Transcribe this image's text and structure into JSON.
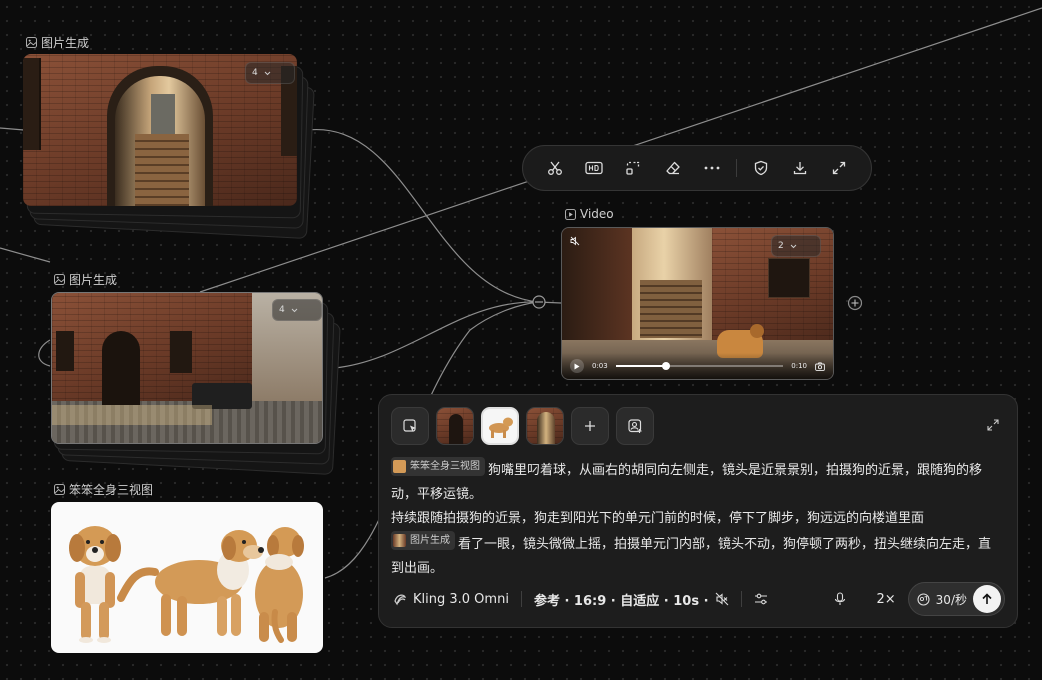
{
  "nodes": {
    "image_gen_1": {
      "label": "图片生成",
      "badge_count": "4"
    },
    "image_gen_2": {
      "label": "图片生成",
      "badge_count": "4"
    },
    "reference": {
      "label": "笨笨全身三视图"
    },
    "video": {
      "label": "Video",
      "badge_count": "2",
      "time_current": "0:03",
      "time_total": "0:10",
      "progress": 0.3
    }
  },
  "toolbar": {
    "items": [
      "scissors-icon",
      "hd-icon",
      "crop-icon",
      "eraser-icon",
      "more-icon",
      "shield-icon",
      "download-icon",
      "expand-icon"
    ]
  },
  "panel": {
    "prompt": {
      "chip_reference": "笨笨全身三视图",
      "text_1": "狗嘴里叼着球，从画右的胡同向左侧走，镜头是近景景别，拍摄狗的近景，跟随狗的移动，平移运镜。",
      "text_2": "持续跟随拍摄狗的近景，狗走到阳光下的单元门前的时候，停下了脚步，狗远远的向楼道里面",
      "chip_image": "图片生成",
      "text_3": "看了一眼，镜头微微上摇，拍摄单元门内部，镜头不动，狗停顿了两秒，扭头继续向左走，直到出画。"
    },
    "footer": {
      "model": "Kling 3.0 Omni",
      "settings": "参考 · 16:9 · 自适应 · 10s ·",
      "multiplier": "2×",
      "cost": "30/秒"
    }
  },
  "colors": {
    "background": "#0c0c0c",
    "panel": "#1d1d1d",
    "accent": "#f2f2f2"
  }
}
